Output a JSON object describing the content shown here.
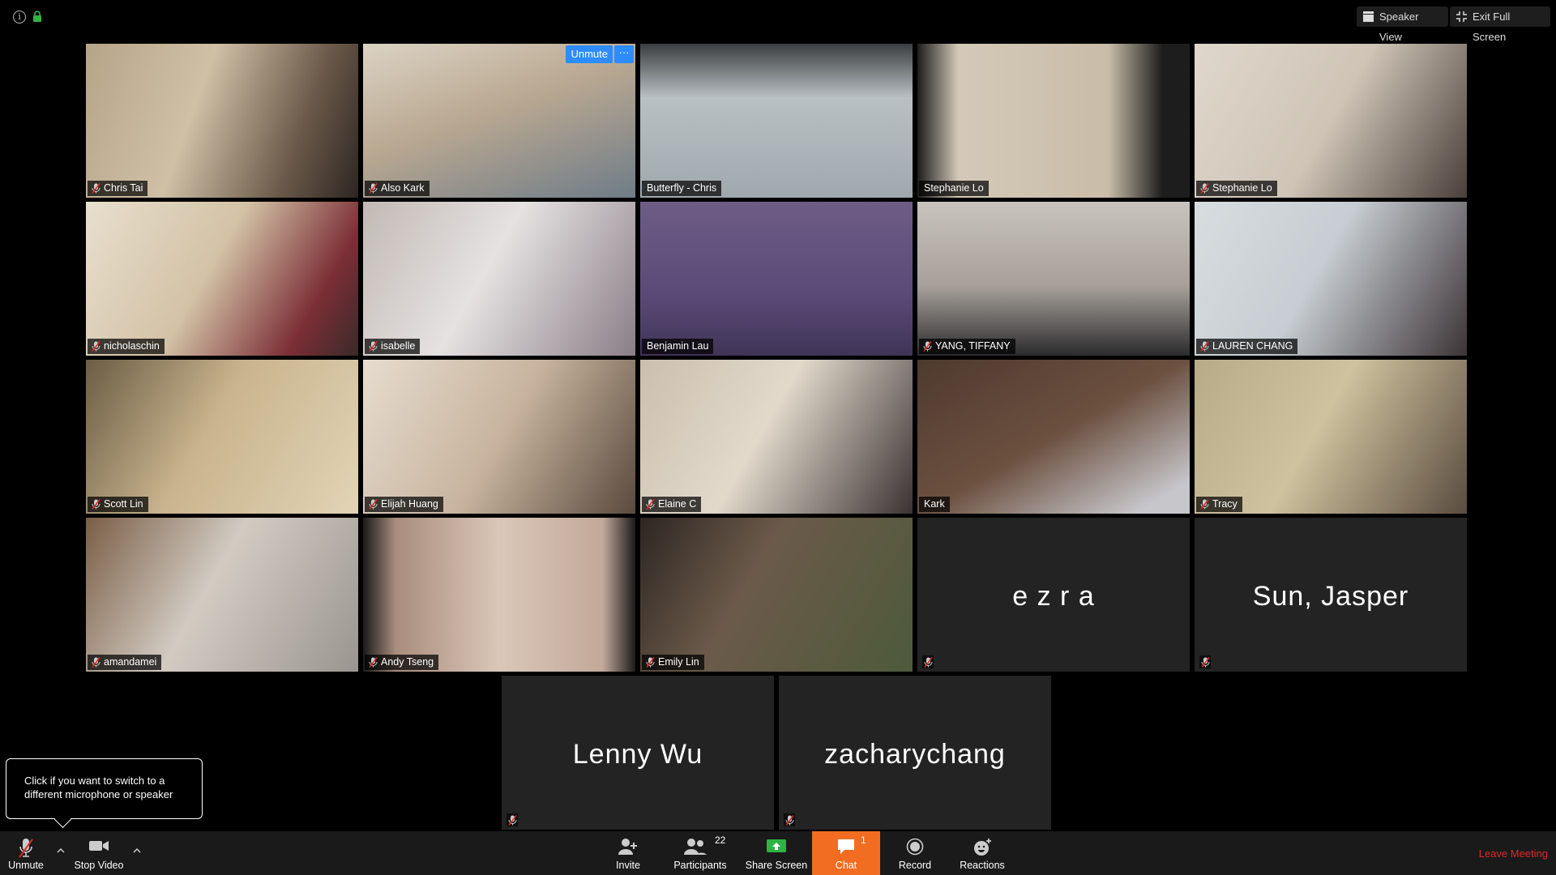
{
  "topbar": {
    "speaker_view_label": "Speaker View",
    "exit_fullscreen_label": "Exit Full Screen"
  },
  "participants": [
    {
      "name": "Chris Tai",
      "muted": true
    },
    {
      "name": "Also Kark",
      "muted": true
    },
    {
      "name": "Butterfly - Chris",
      "muted": false
    },
    {
      "name": "Stephanie Lo",
      "muted": false
    },
    {
      "name": "Stephanie Lo",
      "muted": true
    },
    {
      "name": "nicholaschin",
      "muted": true
    },
    {
      "name": "isabelle",
      "muted": true
    },
    {
      "name": "Benjamin Lau",
      "muted": false
    },
    {
      "name": "YANG, TIFFANY",
      "muted": true
    },
    {
      "name": "LAUREN CHANG",
      "muted": true
    },
    {
      "name": "Scott Lin",
      "muted": true
    },
    {
      "name": "Elijah Huang",
      "muted": true
    },
    {
      "name": "Elaine C",
      "muted": true
    },
    {
      "name": "Kark",
      "muted": false
    },
    {
      "name": "Tracy",
      "muted": true
    },
    {
      "name": "amandamei",
      "muted": true
    },
    {
      "name": "Andy Tseng",
      "muted": true
    },
    {
      "name": "Emily Lin",
      "muted": true
    },
    {
      "name": "e z r a",
      "muted": true
    },
    {
      "name": "Sun, Jasper",
      "muted": true
    },
    {
      "name": "Lenny Wu",
      "muted": true
    },
    {
      "name": "zacharychang",
      "muted": true
    }
  ],
  "self_tile": {
    "unmute_label": "Unmute",
    "more_label": "···"
  },
  "tooltip": {
    "text": "Click if you want to switch to a different microphone or speaker"
  },
  "toolbar": {
    "unmute_label": "Unmute",
    "stop_video_label": "Stop Video",
    "invite_label": "Invite",
    "participants_label": "Participants",
    "participants_count": "22",
    "share_screen_label": "Share Screen",
    "chat_label": "Chat",
    "chat_count": "1",
    "record_label": "Record",
    "reactions_label": "Reactions",
    "leave_label": "Leave Meeting"
  },
  "colors": {
    "accent_blue": "#2d8cff",
    "chat_orange": "#f26d21",
    "leave_red": "#e02828",
    "active_speaker": "#d8d06b",
    "share_green": "#2fb344"
  }
}
